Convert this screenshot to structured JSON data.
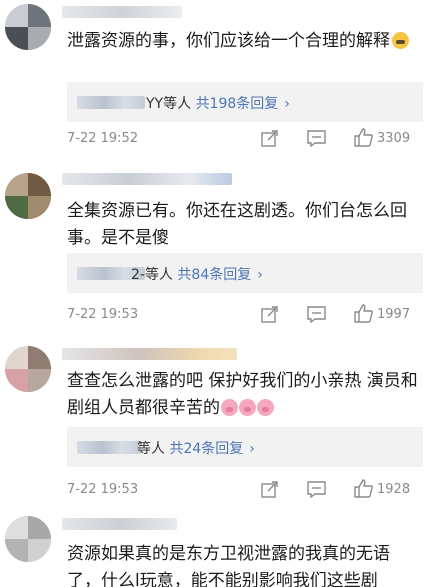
{
  "comments": [
    {
      "text": "泄露资源的事，你们应该给一个合理的解释",
      "emoji": "crying-face",
      "reply_suffix": "YY等人",
      "reply_count": "共198条回复",
      "reply_chevron": "›",
      "timestamp": "7-22 19:52",
      "likes": "3309"
    },
    {
      "text": "全集资源已有。你还在这剧透。你们台怎么回事。是不是傻",
      "reply_suffix": "2-等人",
      "reply_count": "共84条回复",
      "reply_chevron": "›",
      "timestamp": "7-22 19:53",
      "likes": "1997"
    },
    {
      "text": "查查怎么泄露的吧 保护好我们的小亲热 演员和剧组人员都很辛苦的",
      "emoji": "pig-face x3",
      "reply_suffix": "等人",
      "reply_count": "共24条回复",
      "reply_chevron": "›",
      "timestamp": "7-22 19:53",
      "likes": "1928"
    },
    {
      "text": "资源如果真的是东方卫视泄露的我真的无语了，什么l玩意，能不能别影响我们这些剧"
    }
  ],
  "colors": {
    "link_blue": "#4c76b3",
    "reply_box_bg": "#f2f2f2",
    "meta_gray": "#8a8a8a"
  }
}
